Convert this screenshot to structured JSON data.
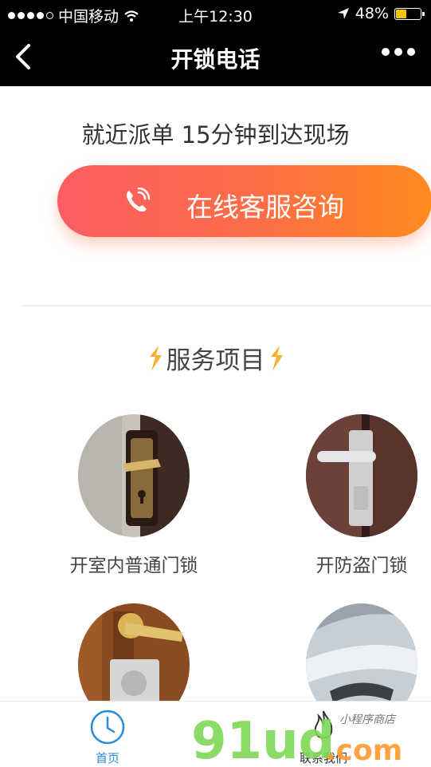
{
  "status": {
    "carrier": "中国移动",
    "time": "上午12:30",
    "battery": "48%",
    "battery_level": 0.48
  },
  "nav": {
    "title": "开锁电话"
  },
  "headline": "就近派单 15分钟到达现场",
  "cta": {
    "label": "在线客服咨询"
  },
  "section": {
    "title": "服务项目"
  },
  "services": [
    {
      "name": "开室内普通门锁"
    },
    {
      "name": "开防盗门锁"
    },
    {
      "name": ""
    },
    {
      "name": ""
    }
  ],
  "tabs": [
    {
      "label": "首页"
    },
    {
      "label": "联系我们"
    }
  ],
  "watermark": {
    "brand": "91ud.com",
    "tagline": "小程序商店"
  },
  "colors": {
    "cta_start": "#fb5d63",
    "cta_end": "#ff8a1e",
    "tab_active": "#2a8cdc",
    "watermark_green": "#7ed957"
  }
}
